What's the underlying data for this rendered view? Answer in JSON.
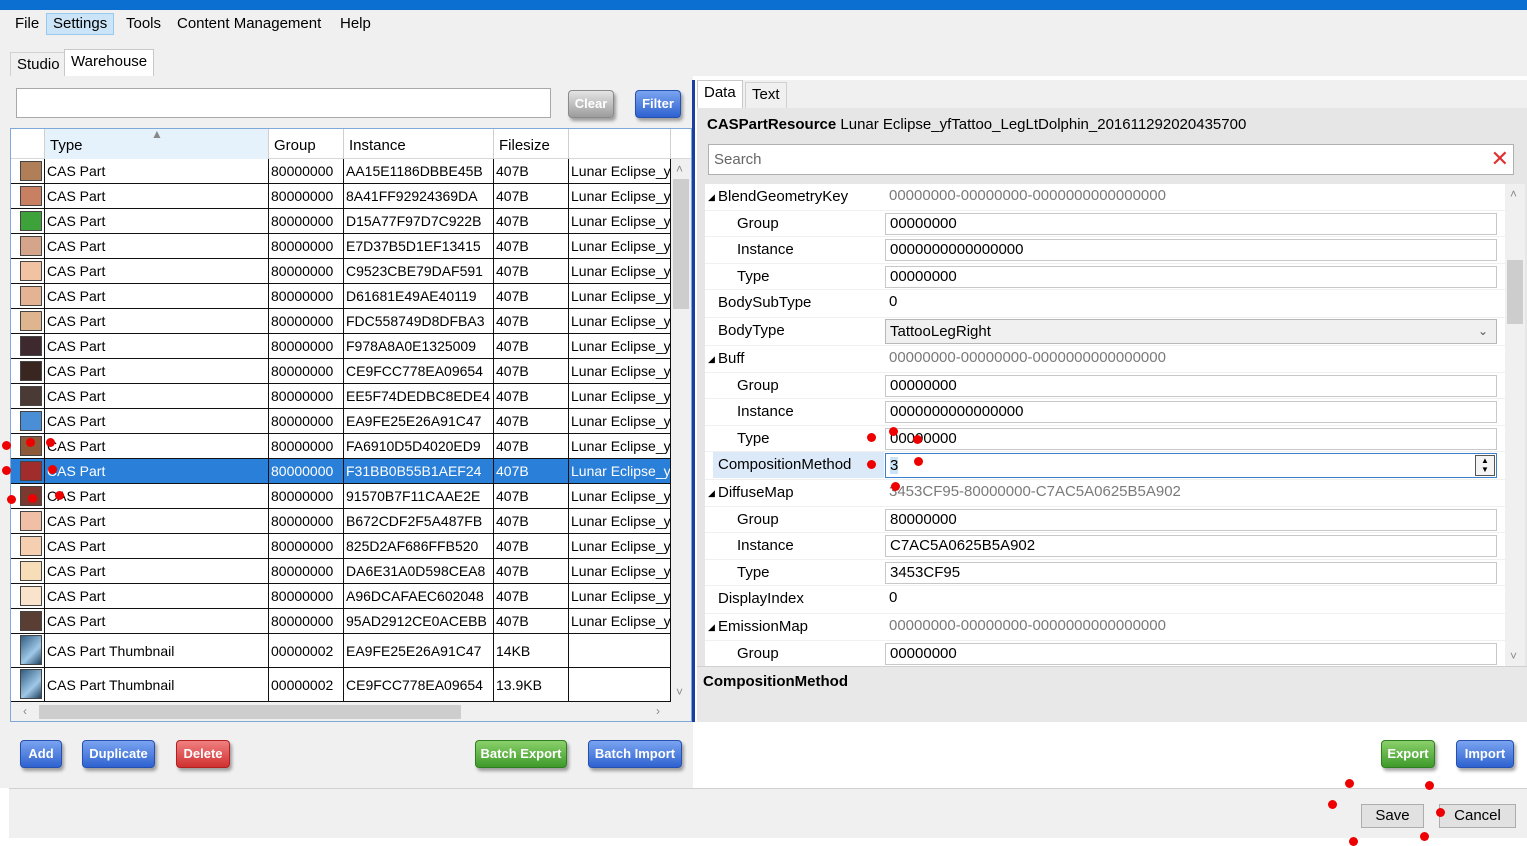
{
  "menu": [
    "File",
    "Settings",
    "Tools",
    "Content Management",
    "Help"
  ],
  "main_tabs": [
    "Studio",
    "Warehouse"
  ],
  "left": {
    "filter_value": "",
    "clear_label": "Clear",
    "filter_label": "Filter",
    "columns": [
      "Type",
      "Group",
      "Instance",
      "Filesize"
    ],
    "rows": [
      {
        "color": "#b07e57",
        "type": "CAS Part",
        "group": "80000000",
        "instance": "AA15E1186DBBE45B",
        "size": "407B",
        "name": "Lunar Eclipse_y"
      },
      {
        "color": "#c97f62",
        "type": "CAS Part",
        "group": "80000000",
        "instance": "8A41FF92924369DA",
        "size": "407B",
        "name": "Lunar Eclipse_y"
      },
      {
        "color": "#3da23a",
        "type": "CAS Part",
        "group": "80000000",
        "instance": "D15A77F97D7C922B",
        "size": "407B",
        "name": "Lunar Eclipse_y"
      },
      {
        "color": "#d4a58a",
        "type": "CAS Part",
        "group": "80000000",
        "instance": "E7D37B5D1EF13415",
        "size": "407B",
        "name": "Lunar Eclipse_y"
      },
      {
        "color": "#f2c3a2",
        "type": "CAS Part",
        "group": "80000000",
        "instance": "C9523CBE79DAF591",
        "size": "407B",
        "name": "Lunar Eclipse_y"
      },
      {
        "color": "#e4b393",
        "type": "CAS Part",
        "group": "80000000",
        "instance": "D61681E49AE40119",
        "size": "407B",
        "name": "Lunar Eclipse_y"
      },
      {
        "color": "#dfb58f",
        "type": "CAS Part",
        "group": "80000000",
        "instance": "FDC558749D8DFBA3",
        "size": "407B",
        "name": "Lunar Eclipse_y"
      },
      {
        "color": "#3e2a2e",
        "type": "CAS Part",
        "group": "80000000",
        "instance": "F978A8A0E1325009",
        "size": "407B",
        "name": "Lunar Eclipse_y"
      },
      {
        "color": "#3a2620",
        "type": "CAS Part",
        "group": "80000000",
        "instance": "CE9FCC778EA09654",
        "size": "407B",
        "name": "Lunar Eclipse_y"
      },
      {
        "color": "#4a3a36",
        "type": "CAS Part",
        "group": "80000000",
        "instance": "EE5F74DEDBC8EDE4",
        "size": "407B",
        "name": "Lunar Eclipse_y"
      },
      {
        "color": "#4a8ed6",
        "type": "CAS Part",
        "group": "80000000",
        "instance": "EA9FE25E26A91C47",
        "size": "407B",
        "name": "Lunar Eclipse_y"
      },
      {
        "color": "#8c5a3a",
        "type": "CAS Part",
        "group": "80000000",
        "instance": "FA6910D5D4020ED9",
        "size": "407B",
        "name": "Lunar Eclipse_y"
      },
      {
        "color": "#a02c2c",
        "type": "CAS Part",
        "group": "80000000",
        "instance": "F31BB0B55B1AEF24",
        "size": "407B",
        "name": "Lunar Eclipse_y",
        "selected": true
      },
      {
        "color": "#7a3a30",
        "type": "CAS Part",
        "group": "80000000",
        "instance": "91570B7F11CAAE2E",
        "size": "407B",
        "name": "Lunar Eclipse_y"
      },
      {
        "color": "#f0bfa6",
        "type": "CAS Part",
        "group": "80000000",
        "instance": "B672CDF2F5A487FB",
        "size": "407B",
        "name": "Lunar Eclipse_y"
      },
      {
        "color": "#f5cfb0",
        "type": "CAS Part",
        "group": "80000000",
        "instance": "825D2AF686FFB520",
        "size": "407B",
        "name": "Lunar Eclipse_y"
      },
      {
        "color": "#f7ddb8",
        "type": "CAS Part",
        "group": "80000000",
        "instance": "DA6E31A0D598CEA8",
        "size": "407B",
        "name": "Lunar Eclipse_y"
      },
      {
        "color": "#f9e4cb",
        "type": "CAS Part",
        "group": "80000000",
        "instance": "A96DCAFAEC602048",
        "size": "407B",
        "name": "Lunar Eclipse_y"
      },
      {
        "color": "#5a3d33",
        "type": "CAS Part",
        "group": "80000000",
        "instance": "95AD2912CE0ACEBB",
        "size": "407B",
        "name": "Lunar Eclipse_y"
      },
      {
        "thumb": true,
        "type": "CAS Part Thumbnail",
        "group": "00000002",
        "instance": "EA9FE25E26A91C47",
        "size": "14KB",
        "name": ""
      },
      {
        "thumb": true,
        "type": "CAS Part Thumbnail",
        "group": "00000002",
        "instance": "CE9FCC778EA09654",
        "size": "13.9KB",
        "name": ""
      }
    ],
    "buttons": {
      "add": "Add",
      "duplicate": "Duplicate",
      "delete": "Delete",
      "batch_export": "Batch Export",
      "batch_import": "Batch Import"
    }
  },
  "right": {
    "tabs": [
      "Data",
      "Text"
    ],
    "resource_type": "CASPartResource",
    "resource_name": "Lunar Eclipse_yfTattoo_LegLtDolphin_201611292020435700",
    "search_placeholder": "Search",
    "props": [
      {
        "name": "BlendGeometryKey",
        "value": "00000000-00000000-0000000000000000",
        "kind": "gray",
        "expand": true
      },
      {
        "name": "Group",
        "value": "00000000",
        "kind": "box",
        "indent": true
      },
      {
        "name": "Instance",
        "value": "0000000000000000",
        "kind": "box",
        "indent": true
      },
      {
        "name": "Type",
        "value": "00000000",
        "kind": "box",
        "indent": true
      },
      {
        "name": "BodySubType",
        "value": "0",
        "kind": "plain"
      },
      {
        "name": "BodyType",
        "value": "TattooLegRight",
        "kind": "combo"
      },
      {
        "name": "Buff",
        "value": "00000000-00000000-0000000000000000",
        "kind": "gray",
        "expand": true
      },
      {
        "name": "Group",
        "value": "00000000",
        "kind": "box",
        "indent": true
      },
      {
        "name": "Instance",
        "value": "0000000000000000",
        "kind": "box",
        "indent": true
      },
      {
        "name": "Type",
        "value": "00000000",
        "kind": "box",
        "indent": true
      },
      {
        "name": "CompositionMethod",
        "value": "3",
        "kind": "spin",
        "selected": true
      },
      {
        "name": "DiffuseMap",
        "value": "3453CF95-80000000-C7AC5A0625B5A902",
        "kind": "gray",
        "expand": true
      },
      {
        "name": "Group",
        "value": "80000000",
        "kind": "box",
        "indent": true
      },
      {
        "name": "Instance",
        "value": "C7AC5A0625B5A902",
        "kind": "box",
        "indent": true
      },
      {
        "name": "Type",
        "value": "3453CF95",
        "kind": "box",
        "indent": true
      },
      {
        "name": "DisplayIndex",
        "value": "0",
        "kind": "plain"
      },
      {
        "name": "EmissionMap",
        "value": "00000000-00000000-0000000000000000",
        "kind": "gray",
        "expand": true
      },
      {
        "name": "Group",
        "value": "00000000",
        "kind": "box",
        "indent": true
      }
    ],
    "description_title": "CompositionMethod",
    "buttons": {
      "export": "Export",
      "import": "Import"
    }
  },
  "footer": {
    "save": "Save",
    "cancel": "Cancel"
  }
}
